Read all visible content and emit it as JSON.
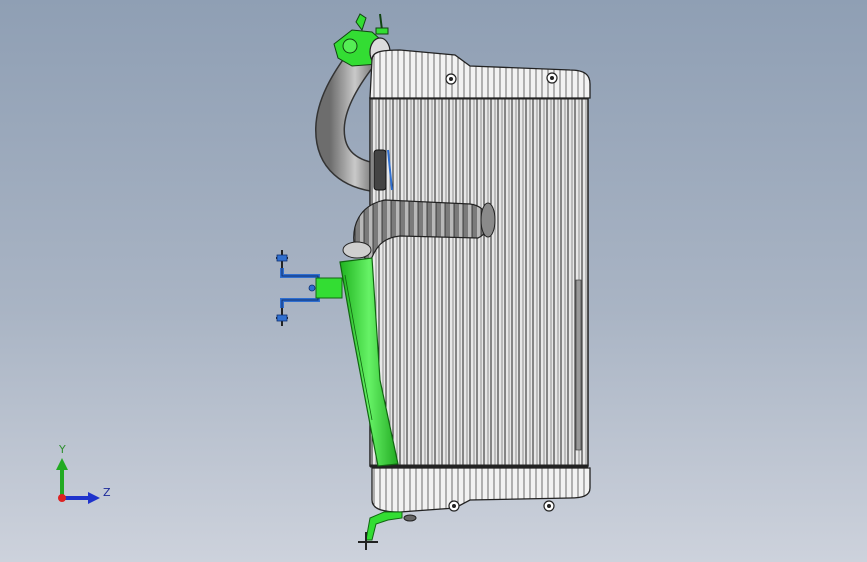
{
  "viewport": {
    "background_top": "#8f9fb4",
    "background_bottom": "#cdd2dc"
  },
  "model": {
    "subject": "intercooler-assembly",
    "highlight_color": "#33dd33",
    "bracket_color": "#2f6fd0"
  },
  "triad": {
    "y_label": "Y",
    "z_label": "Z",
    "y_color": "#22aa22",
    "z_color": "#1f33cc",
    "x_color": "#dd2222"
  }
}
